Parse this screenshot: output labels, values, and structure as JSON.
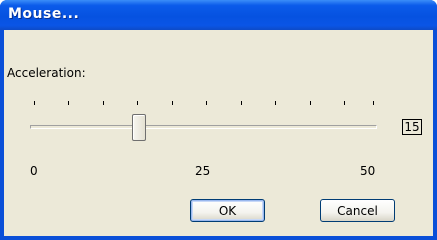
{
  "window": {
    "title": "Mouse..."
  },
  "dialog": {
    "label": "Acceleration:",
    "slider": {
      "min": 0,
      "max": 50,
      "value": 15,
      "tick_count": 11
    },
    "value_display": "15",
    "scale_labels": {
      "min": "0",
      "mid": "25",
      "max": "50"
    }
  },
  "buttons": {
    "ok": "OK",
    "cancel": "Cancel"
  },
  "colors": {
    "titlebar": "#0652e0",
    "client": "#ece9d8",
    "button_border": "#003c74"
  }
}
